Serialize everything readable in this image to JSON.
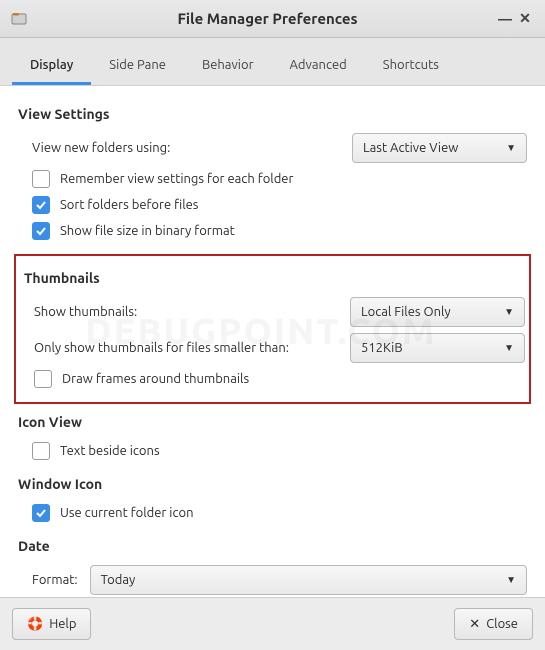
{
  "window": {
    "title": "File Manager Preferences"
  },
  "tabs": {
    "display": "Display",
    "side_pane": "Side Pane",
    "behavior": "Behavior",
    "advanced": "Advanced",
    "shortcuts": "Shortcuts"
  },
  "view_settings": {
    "heading": "View Settings",
    "new_folders_label": "View new folders using:",
    "new_folders_value": "Last Active View",
    "remember_view": "Remember view settings for each folder",
    "sort_before": "Sort folders before files",
    "binary_size": "Show file size in binary format"
  },
  "thumbnails": {
    "heading": "Thumbnails",
    "show_label": "Show thumbnails:",
    "show_value": "Local Files Only",
    "size_label": "Only show thumbnails for files smaller than:",
    "size_value": "512KiB",
    "draw_frames": "Draw frames around thumbnails"
  },
  "icon_view": {
    "heading": "Icon View",
    "text_beside": "Text beside icons"
  },
  "window_icon": {
    "heading": "Window Icon",
    "use_current": "Use current folder icon"
  },
  "date": {
    "heading": "Date",
    "format_label": "Format:",
    "format_value": "Today"
  },
  "footer": {
    "help": "Help",
    "close": "Close"
  },
  "watermark": "DEBUGPOINT.COM"
}
